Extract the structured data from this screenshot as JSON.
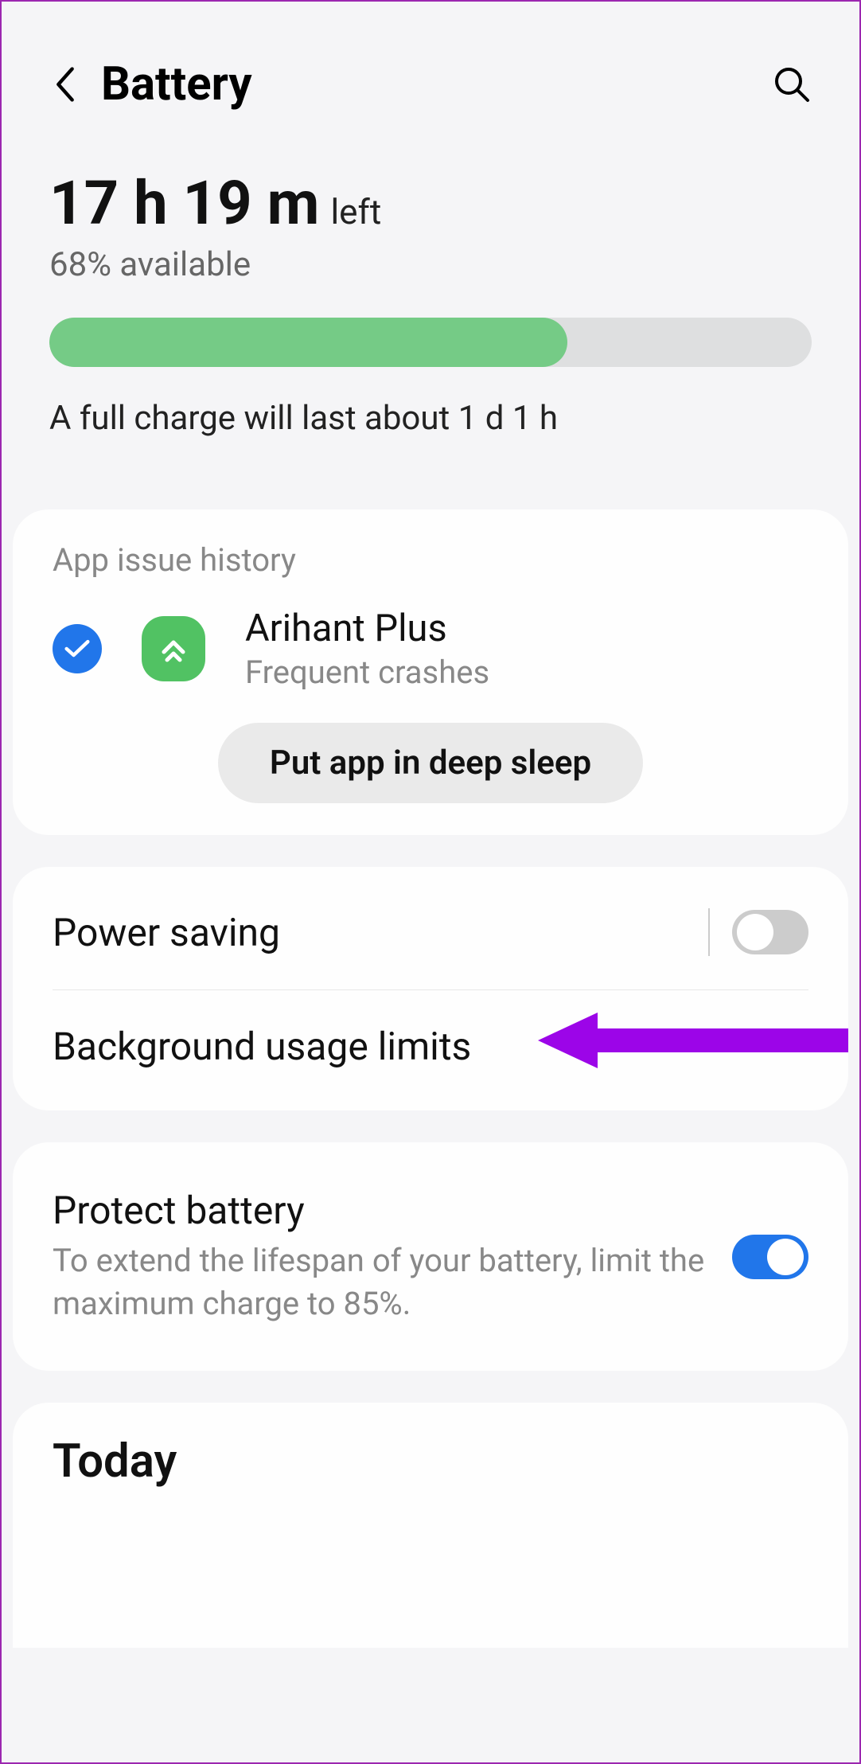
{
  "header": {
    "title": "Battery"
  },
  "summary": {
    "time_value": "17 h 19 m",
    "time_suffix": "left",
    "percent_available": "68% available",
    "progress_percent": 68,
    "full_charge": "A full charge will last about 1 d 1 h"
  },
  "app_issue": {
    "section_label": "App issue history",
    "app_name": "Arihant Plus",
    "issue_text": "Frequent crashes",
    "action_label": "Put app in deep sleep"
  },
  "settings": {
    "power_saving": {
      "label": "Power saving",
      "enabled": false
    },
    "bg_limits": {
      "label": "Background usage limits"
    },
    "protect_battery": {
      "label": "Protect battery",
      "description": "To extend the lifespan of your battery, limit the maximum charge to 85%.",
      "enabled": true
    }
  },
  "today": {
    "title": "Today"
  },
  "annotation": {
    "color": "#9c05e8"
  }
}
